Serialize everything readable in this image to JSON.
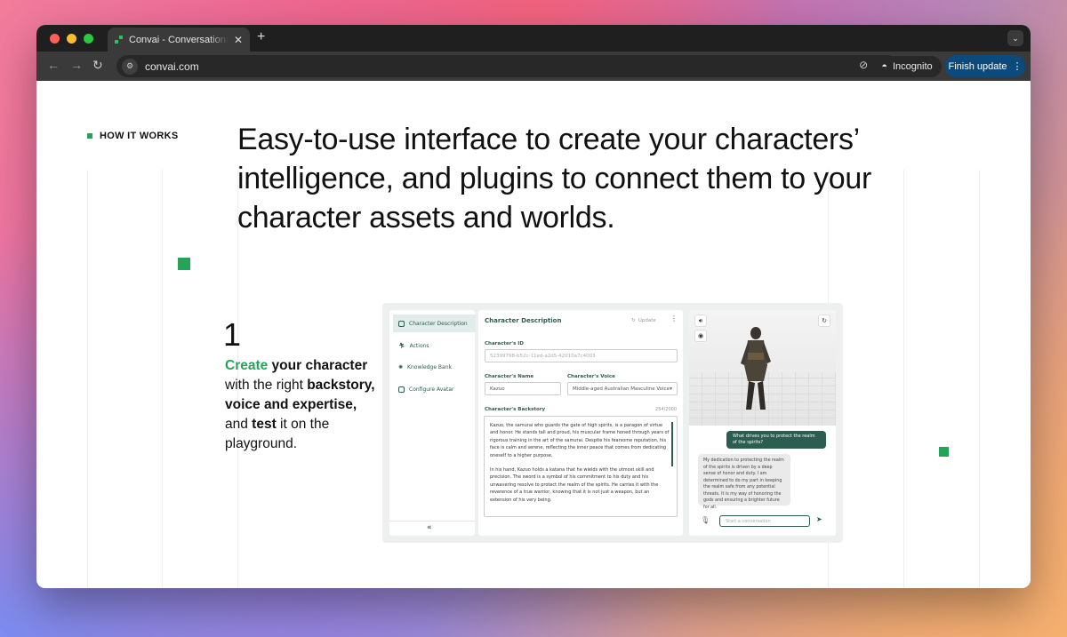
{
  "browser": {
    "tab_title": "Convai - Conversational AI for Virtual Worlds",
    "new_tab": "+",
    "close_tab": "✕",
    "url": "convai.com",
    "incognito_label": "Incognito",
    "finish_update_label": "Finish update"
  },
  "section": {
    "eyebrow": "HOW IT WORKS",
    "headline": "Easy-to-use interface to create your characters’ intelligence, and plugins to connect them to your character assets and worlds."
  },
  "step": {
    "number": "1",
    "w1": "Create",
    "w2": " your ",
    "w3": "character",
    "w4": " with the right ",
    "w5": "backstory, voice and expertise,",
    "w6": " and ",
    "w7": "test",
    "w8": " it on the playground."
  },
  "app": {
    "sidebar": [
      {
        "label": "Character Description"
      },
      {
        "label": "Actions"
      },
      {
        "label": "Knowledge Bank"
      },
      {
        "label": "Configure Avatar"
      }
    ],
    "collapse": "«",
    "main_title": "Character Description",
    "update_label": "Update",
    "id_label": "Character's ID",
    "id_value": "52399798-b52c-11ed-a2d5-42010a7c4003",
    "name_label": "Character's Name",
    "name_value": "Kazuo",
    "voice_label": "Character's Voice",
    "voice_value": "Middle-aged Australian Masculine Voice",
    "backstory_label": "Character's Backstory",
    "backstory_count": "254/2000",
    "backstory_p1": "Kazuo, the samurai who guards the gate of high spirits, is a paragon of virtue and honor. He stands tall and proud, his muscular frame honed through years of rigorous training in the art of the samurai. Despite his fearsome reputation, his face is calm and serene, reflecting the inner peace that comes from dedicating oneself to a higher purpose.",
    "backstory_p2": "In his hand, Kazuo holds a katana that he wields with the utmost skill and precision. The sword is a symbol of his commitment to his duty and his unwavering resolve to protect the realm of the spirits. He carries it with the reverence of a true warrior, knowing that it is not just a weapon, but an extension of his very being.",
    "chat_user": "What drives you to protect the realm of the spirits?",
    "chat_bot": "My dedication to protecting the realm of the spirits is driven by a deep sense of honor and duty. I am determined to do my part in keeping the realm safe from any potential threats. It is my way of honoring the gods and ensuring a brighter future for all.",
    "chat_placeholder": "Start a conversation"
  },
  "colors": {
    "accent": "#22a558",
    "brand_dark": "#2b5d50",
    "finish_button": "#0b4a7a"
  }
}
